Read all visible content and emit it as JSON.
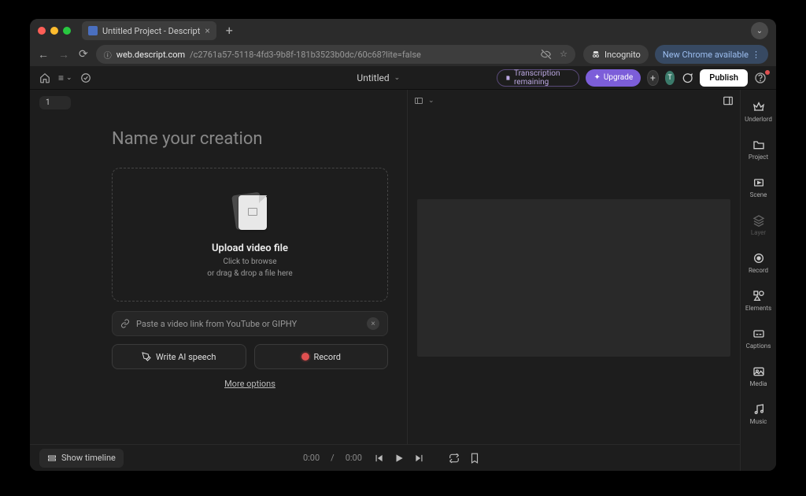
{
  "browser": {
    "tab_title": "Untitled Project - Descript",
    "url_domain": "web.descript.com",
    "url_path": "/c2761a57-5118-4fd3-9b8f-181b3523b0dc/60c68?lite=false",
    "incognito_label": "Incognito",
    "update_label": "New Chrome available"
  },
  "header": {
    "project_title": "Untitled",
    "transcription_label": "Transcription remaining",
    "upgrade_label": "Upgrade",
    "avatar_initial": "T",
    "publish_label": "Publish"
  },
  "left": {
    "speaker_chip": "1",
    "name_placeholder": "Name your creation",
    "dropzone_title": "Upload video file",
    "dropzone_sub1": "Click to browse",
    "dropzone_sub2": "or drag & drop a file here",
    "paste_placeholder": "Paste a video link from YouTube or GIPHY",
    "write_ai_label": "Write AI speech",
    "record_label": "Record",
    "more_options": "More options"
  },
  "sidebar": {
    "items": [
      {
        "label": "Underlord"
      },
      {
        "label": "Project"
      },
      {
        "label": "Scene"
      },
      {
        "label": "Layer"
      },
      {
        "label": "Record"
      },
      {
        "label": "Elements"
      },
      {
        "label": "Captions"
      },
      {
        "label": "Media"
      },
      {
        "label": "Music"
      }
    ]
  },
  "playback": {
    "current": "0:00",
    "sep": "/",
    "total": "0:00"
  },
  "bottom": {
    "timeline_label": "Show timeline"
  }
}
